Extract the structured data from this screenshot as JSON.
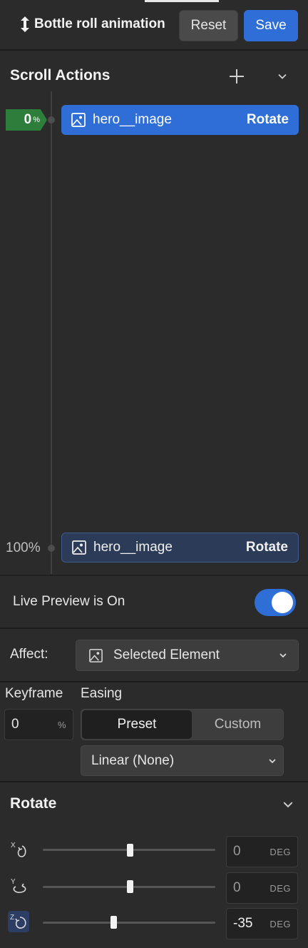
{
  "header": {
    "title": "Bottle roll animation",
    "reset_label": "Reset",
    "save_label": "Save"
  },
  "scroll_actions": {
    "title": "Scroll Actions",
    "start_marker": {
      "value": "0",
      "unit": "%"
    },
    "end_marker": {
      "label": "100%"
    },
    "rows": [
      {
        "element": "hero__image",
        "action": "Rotate",
        "state": "active"
      },
      {
        "element": "hero__image",
        "action": "Rotate",
        "state": "end"
      }
    ]
  },
  "live_preview": {
    "label": "Live Preview is On",
    "on": true
  },
  "affect": {
    "label": "Affect:",
    "value": "Selected Element"
  },
  "keyframe": {
    "label": "Keyframe",
    "value": "0",
    "unit": "%"
  },
  "easing": {
    "label": "Easing",
    "tabs": [
      "Preset",
      "Custom"
    ],
    "active_tab": "Preset",
    "selected": "Linear (None)"
  },
  "rotate": {
    "title": "Rotate",
    "axes": [
      {
        "axis": "X",
        "value": "0",
        "unit": "DEG",
        "slider_fraction": 0.5
      },
      {
        "axis": "Y",
        "value": "0",
        "unit": "DEG",
        "slider_fraction": 0.5
      },
      {
        "axis": "Z",
        "value": "-35",
        "unit": "DEG",
        "slider_fraction": 0.4
      }
    ]
  },
  "colors": {
    "accent": "#2f6ed6",
    "start_marker": "#2f7d3a",
    "panel_bg": "#2b2b2b"
  }
}
